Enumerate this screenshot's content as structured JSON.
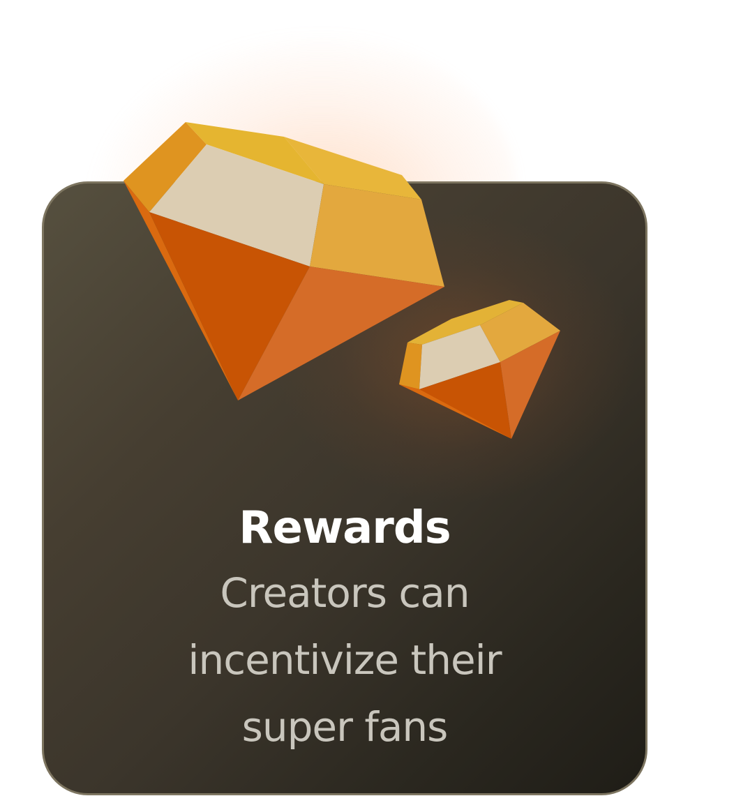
{
  "card": {
    "title": "Rewards",
    "description": "Creators can incentivize their super fans",
    "icon": "gems-icon",
    "colors": {
      "title": "#ffffff",
      "description": "#c9c6bd",
      "card_dark": "#2a271f",
      "gem_orange": "#c85404",
      "gem_gold": "#e6a83e",
      "gem_cream": "#dccdb2"
    }
  }
}
